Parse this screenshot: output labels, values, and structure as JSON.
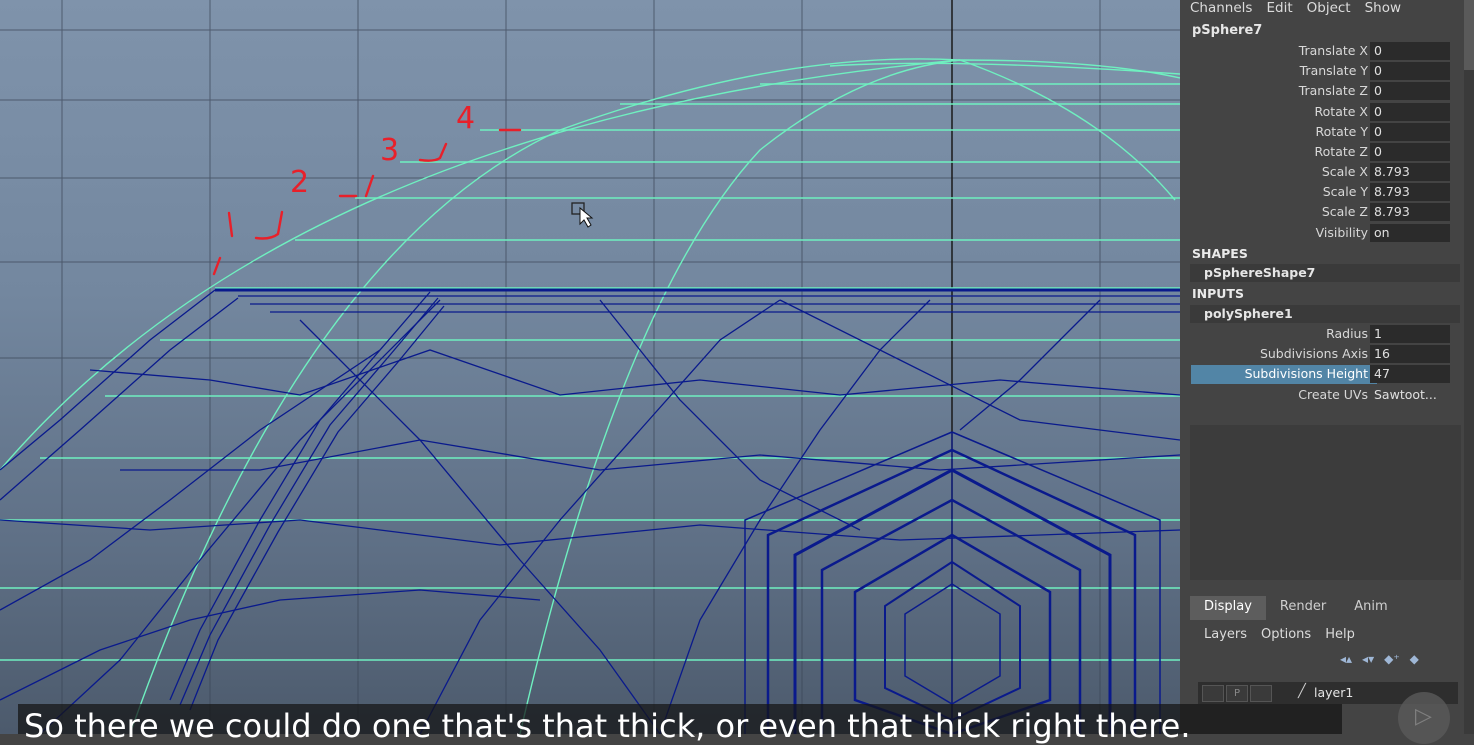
{
  "channel_box": {
    "menu": [
      "Channels",
      "Edit",
      "Object",
      "Show"
    ],
    "node": "pSphere7",
    "attributes": [
      {
        "label": "Translate X",
        "value": "0"
      },
      {
        "label": "Translate Y",
        "value": "0"
      },
      {
        "label": "Translate Z",
        "value": "0"
      },
      {
        "label": "Rotate X",
        "value": "0"
      },
      {
        "label": "Rotate Y",
        "value": "0"
      },
      {
        "label": "Rotate Z",
        "value": "0"
      },
      {
        "label": "Scale X",
        "value": "8.793"
      },
      {
        "label": "Scale Y",
        "value": "8.793"
      },
      {
        "label": "Scale Z",
        "value": "8.793"
      },
      {
        "label": "Visibility",
        "value": "on"
      }
    ],
    "shapes_header": "SHAPES",
    "shape_node": "pSphereShape7",
    "inputs_header": "INPUTS",
    "input_node": "polySphere1",
    "input_attributes": [
      {
        "label": "Radius",
        "value": "1"
      },
      {
        "label": "Subdivisions Axis",
        "value": "16"
      },
      {
        "label": "Subdivisions Height",
        "value": "47",
        "highlighted": true
      },
      {
        "label": "Create UVs",
        "value": "Sawtoot..."
      }
    ]
  },
  "layer_editor": {
    "tabs": [
      "Display",
      "Render",
      "Anim"
    ],
    "active_tab": "Display",
    "menu": [
      "Layers",
      "Options",
      "Help"
    ],
    "layer_p_label": "P",
    "layer_name": "layer1"
  },
  "annotations": [
    "1",
    "2",
    "3",
    "4"
  ],
  "caption": "So there we could do one that's that thick, or even that thick right there.",
  "colors": {
    "wire_cyan": "#6ff0c0",
    "wire_blue": "#0a1a8c",
    "annotation_red": "#e8202a",
    "highlight": "#5285a6"
  }
}
